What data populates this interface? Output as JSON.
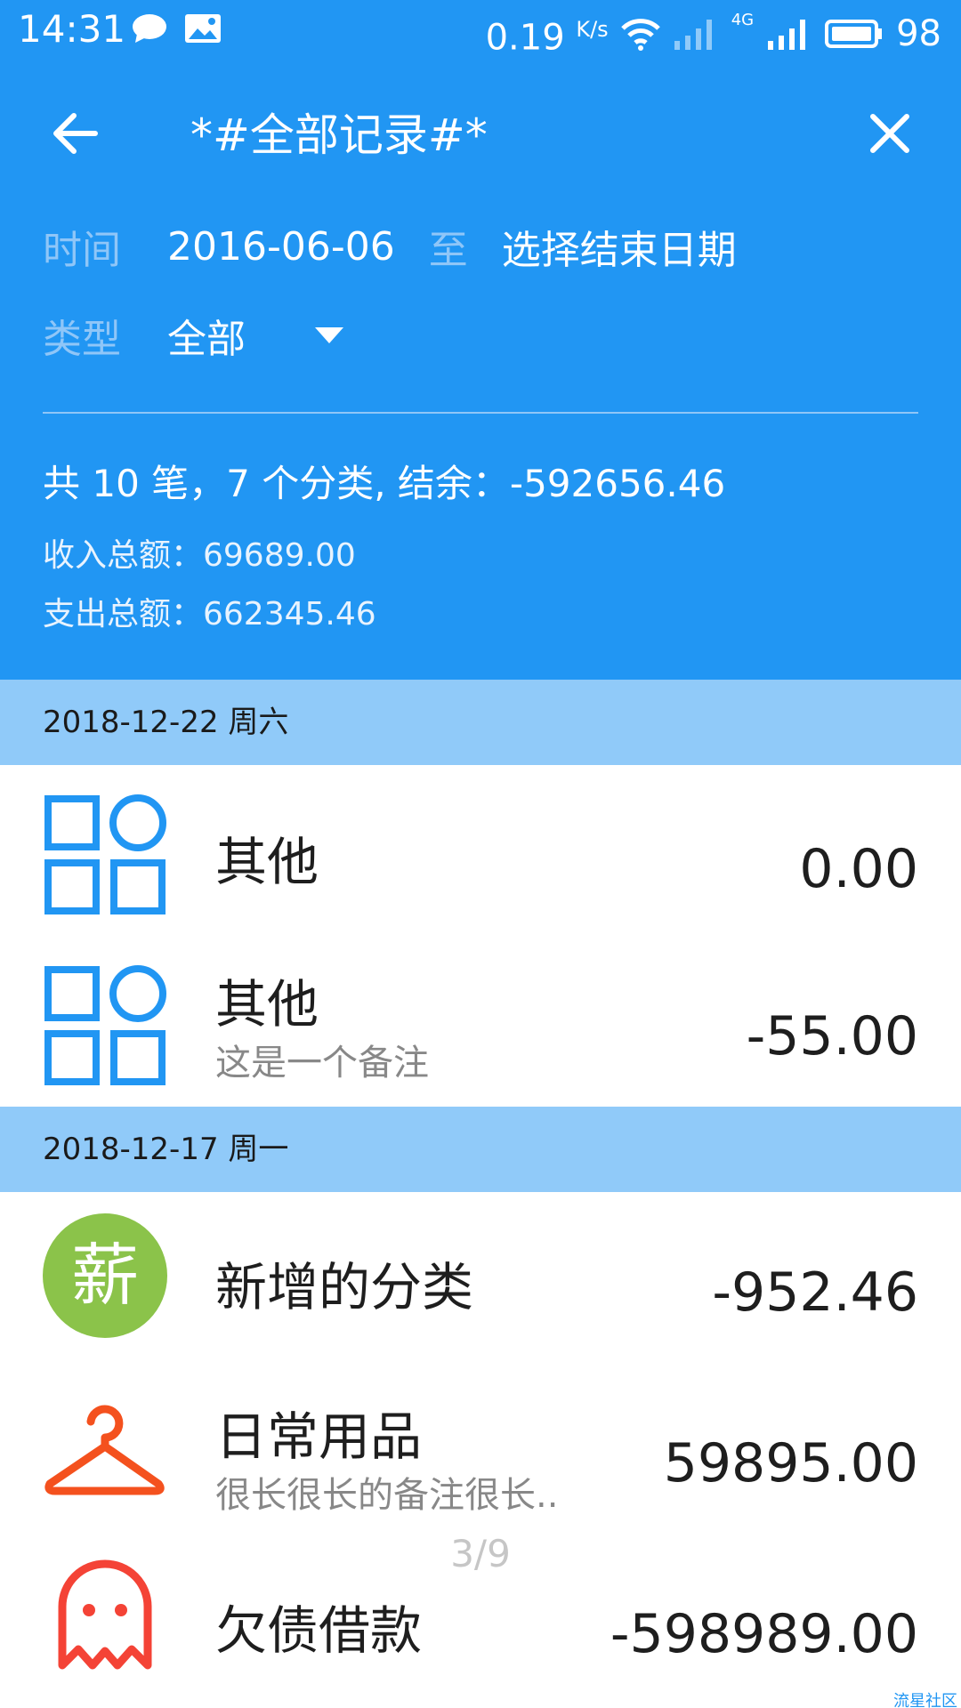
{
  "status_bar": {
    "time": "14:31",
    "speed": "0.19",
    "speed_unit": "K/s",
    "network": "4G",
    "battery": "98"
  },
  "toolbar": {
    "title": "*#全部记录#*",
    "back_icon": "arrow-left-icon",
    "close_icon": "close-icon"
  },
  "filters": {
    "time_label": "时间",
    "start_date": "2016-06-06",
    "to_label": "至",
    "end_date_placeholder": "选择结束日期",
    "type_label": "类型",
    "type_value": "全部"
  },
  "summary": {
    "main": "共 10 笔，7 个分类, 结余：-592656.46",
    "income": "收入总额：69689.00",
    "expense": "支出总额：662345.46"
  },
  "groups": [
    {
      "date": "2018-12-22 周六",
      "items": [
        {
          "icon": "grid-category-icon",
          "title": "其他",
          "note": "",
          "amount": "0.00"
        },
        {
          "icon": "grid-category-icon",
          "title": "其他",
          "note": "这是一个备注",
          "amount": "-55.00"
        }
      ]
    },
    {
      "date": "2018-12-17 周一",
      "items": [
        {
          "icon": "new-category-badge-icon",
          "badge_text": "薪",
          "title": "新增的分类",
          "note": "",
          "amount": "-952.46"
        },
        {
          "icon": "hanger-icon",
          "title": "日常用品",
          "note": "很长很长的备注很长..",
          "amount": "59895.00"
        },
        {
          "icon": "ghost-icon",
          "title": "欠债借款",
          "note": "",
          "amount": "-598989.00"
        }
      ]
    }
  ],
  "pager": "3/9",
  "watermark": "流星社区",
  "colors": {
    "primary": "#2196F3",
    "section": "#90CAF9",
    "green_badge": "#8BC34A",
    "orange": "#F4511E"
  }
}
